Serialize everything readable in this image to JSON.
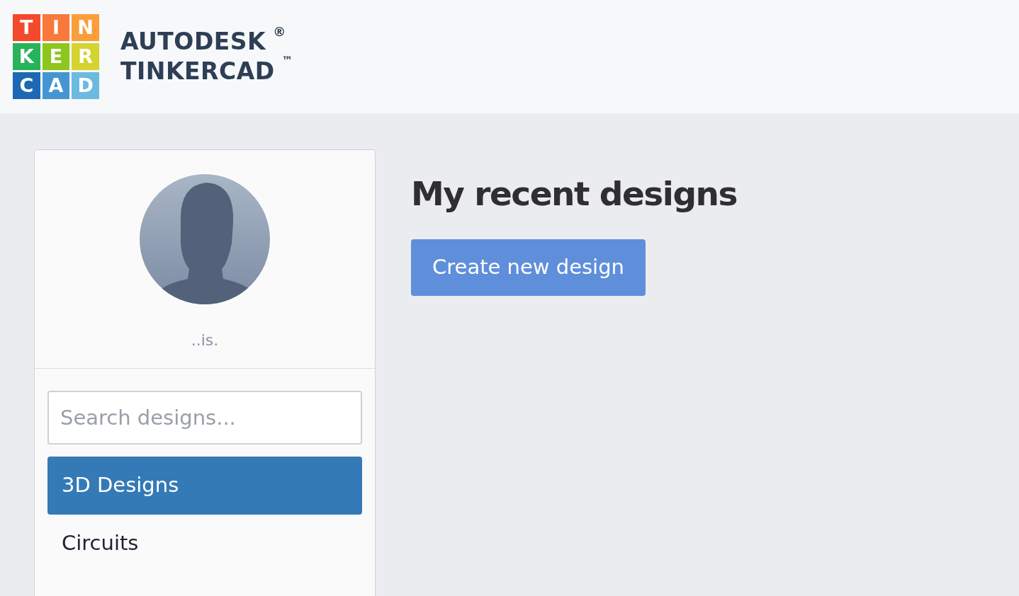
{
  "logo": {
    "tiles": [
      {
        "letter": "T",
        "color": "#f5492d"
      },
      {
        "letter": "I",
        "color": "#f8793b"
      },
      {
        "letter": "N",
        "color": "#fb9e3a"
      },
      {
        "letter": "K",
        "color": "#27b35a"
      },
      {
        "letter": "E",
        "color": "#8dc71e"
      },
      {
        "letter": "R",
        "color": "#d4d330"
      },
      {
        "letter": "C",
        "color": "#1d68b4"
      },
      {
        "letter": "A",
        "color": "#4595d1"
      },
      {
        "letter": "D",
        "color": "#6cbae0"
      }
    ],
    "brand_line_1": "AUTODESK",
    "registered_mark": "®",
    "brand_line_2": "TINKERCAD",
    "trademark": "™"
  },
  "profile": {
    "username": "..is."
  },
  "sidebar": {
    "search": {
      "placeholder": "Search designs..."
    },
    "items": [
      {
        "label": "3D Designs",
        "selected": true
      },
      {
        "label": "Circuits",
        "selected": false
      }
    ]
  },
  "main": {
    "heading": "My recent designs",
    "create_button": "Create new design"
  }
}
